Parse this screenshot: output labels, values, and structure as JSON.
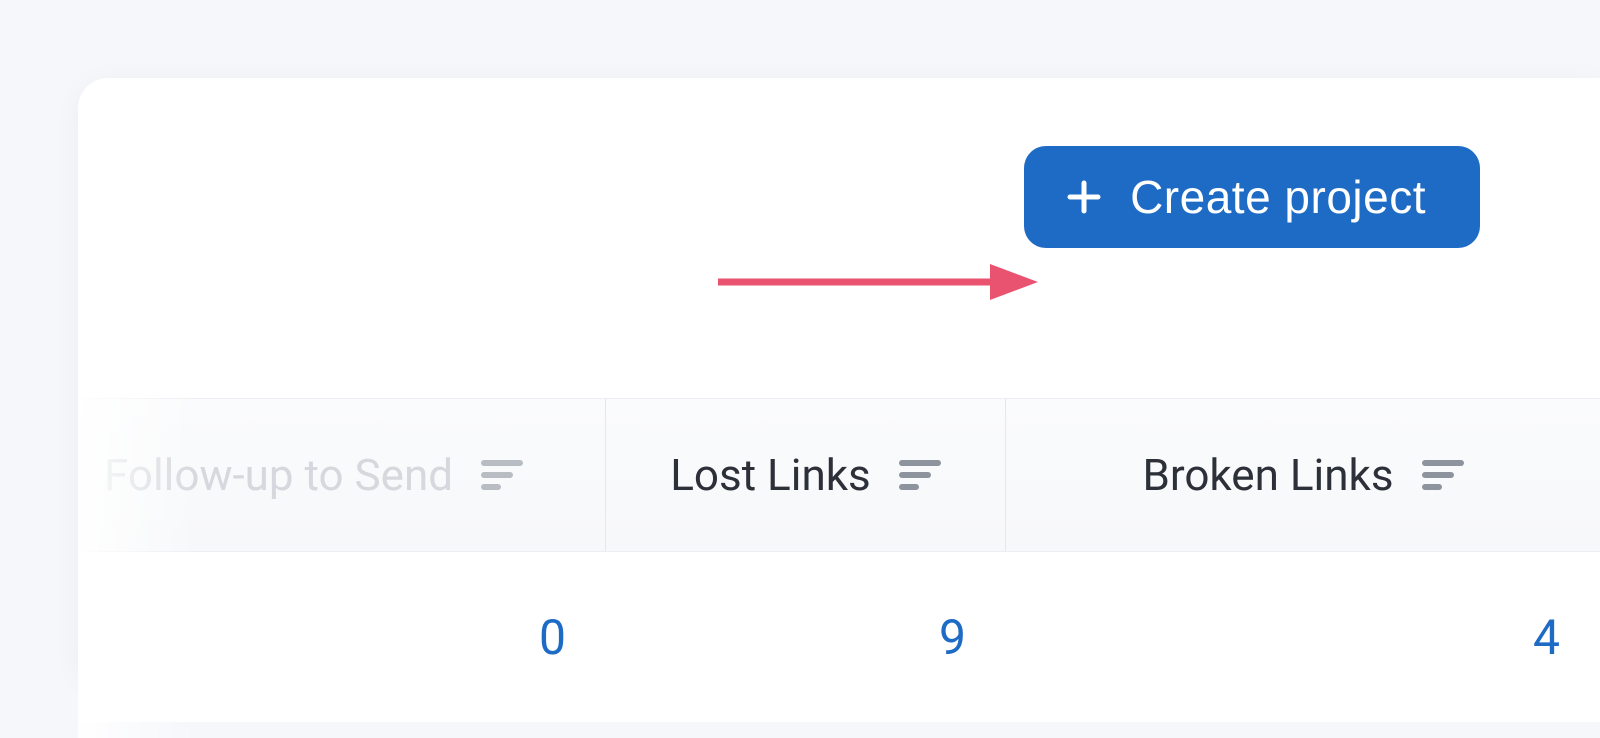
{
  "toolbar": {
    "create_project_label": "Create project"
  },
  "columns": [
    {
      "key": "followup",
      "label": "Follow-up to Send"
    },
    {
      "key": "lost",
      "label": "Lost Links"
    },
    {
      "key": "broken",
      "label": "Broken Links"
    }
  ],
  "row": {
    "followup": "0",
    "lost": "9",
    "broken": "4"
  },
  "colors": {
    "primary": "#1e6bc6",
    "annotation": "#e9536f"
  }
}
